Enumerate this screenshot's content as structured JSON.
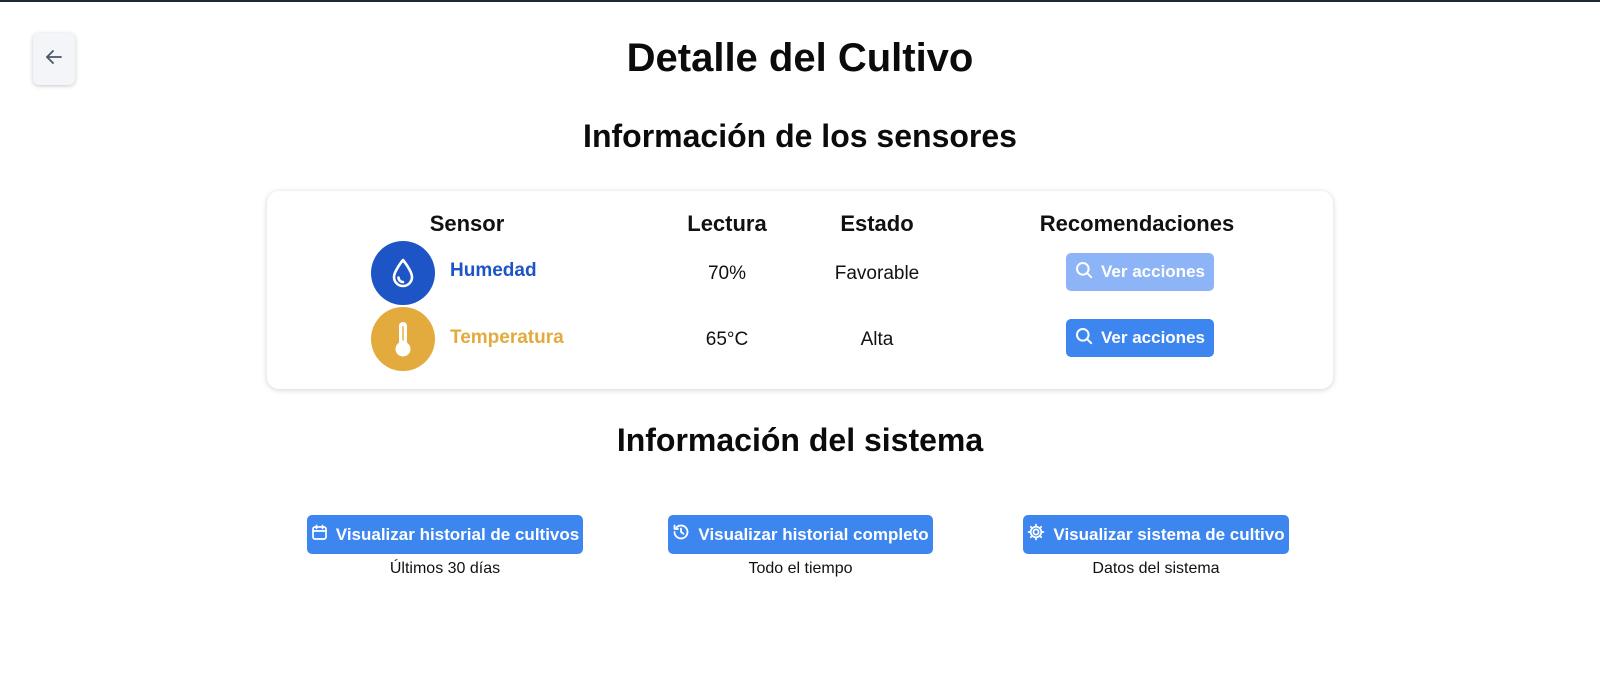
{
  "header": {
    "title": "Detalle del Cultivo",
    "back_icon": "arrow-left-icon"
  },
  "sensors": {
    "title": "Información de los sensores",
    "columns": [
      "Sensor",
      "Lectura",
      "Estado",
      "Recomendaciones"
    ],
    "rows": [
      {
        "name": "Humedad",
        "icon": "water-drop-icon",
        "color": "#1d55c6",
        "reading": "70%",
        "status": "Favorable",
        "action_label": "Ver acciones",
        "action_enabled": false
      },
      {
        "name": "Temperatura",
        "icon": "thermometer-icon",
        "color": "#e3aa3d",
        "reading": "65°C",
        "status": "Alta",
        "action_label": "Ver acciones",
        "action_enabled": true
      }
    ]
  },
  "system": {
    "title": "Información del sistema",
    "items": [
      {
        "label": "Visualizar historial de cultivos",
        "icon": "calendar-icon",
        "subtitle": "Últimos 30 días"
      },
      {
        "label": "Visualizar historial completo",
        "icon": "history-icon",
        "subtitle": "Todo el tiempo"
      },
      {
        "label": "Visualizar sistema de cultivo",
        "icon": "gear-icon",
        "subtitle": "Datos del sistema"
      }
    ]
  },
  "colors": {
    "primary": "#3d86f0",
    "primary_disabled": "#8db4f6",
    "humidity": "#1d55c6",
    "temperature": "#e3aa3d"
  }
}
